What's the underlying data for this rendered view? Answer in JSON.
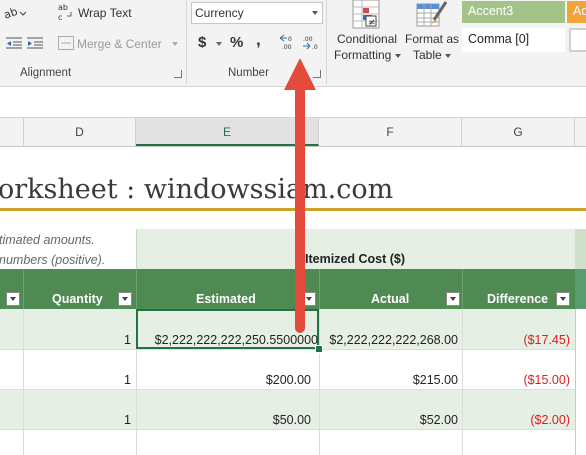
{
  "ribbon": {
    "alignment": {
      "wrap_text": "Wrap Text",
      "merge_center": "Merge & Center",
      "group_label": "Alignment"
    },
    "number": {
      "format_value": "Currency",
      "currency_symbol": "$",
      "percent_symbol": "%",
      "comma_symbol": ",",
      "increase_decimal": "←0 .00",
      "decrease_decimal": ".00 →0",
      "group_label": "Number"
    },
    "styles": {
      "conditional_formatting_line1": "Conditional",
      "conditional_formatting_line2": "Formatting",
      "format_as_table_line1": "Format as",
      "format_as_table_line2": "Table",
      "style_accent3": "Accent3",
      "style_accent4_partial": "Ac",
      "style_comma0": "Comma [0]"
    }
  },
  "columns": [
    "D",
    "E",
    "F",
    "G"
  ],
  "sheet": {
    "title": "orksheet : windowssiam.com",
    "note_line1": "timated amounts.",
    "note_line2": "numbers (positive).",
    "itemized_header": "Itemized Cost ($)",
    "table_headers": {
      "quantity": "Quantity",
      "estimated": "Estimated",
      "actual": "Actual",
      "difference": "Difference"
    },
    "rows": [
      {
        "quantity": "1",
        "estimated": "$2,222,222,222,250.5500000",
        "actual": "$2,222,222,222,268.00",
        "difference": "($17.45)"
      },
      {
        "quantity": "1",
        "estimated": "$200.00",
        "actual": "$215.00",
        "difference": "($15.00)"
      },
      {
        "quantity": "1",
        "estimated": "$50.00",
        "actual": "$52.00",
        "difference": "($2.00)"
      }
    ]
  },
  "colors": {
    "table_header": "#4e8a52",
    "band": "#e6efe3",
    "accent_red": "#e34a3c",
    "negative": "#e01b1b",
    "title_rule": "#c9a227"
  }
}
